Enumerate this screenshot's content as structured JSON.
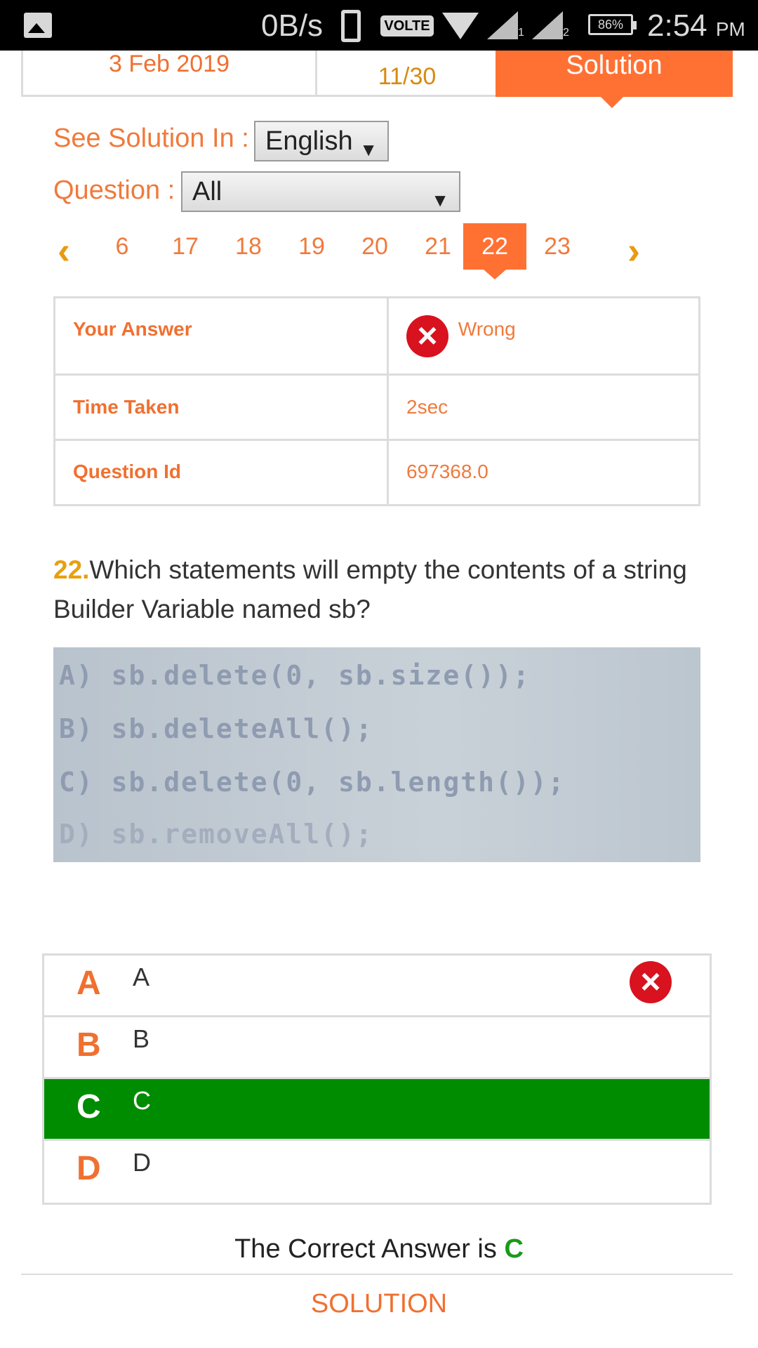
{
  "status_bar": {
    "speed": "0B/s",
    "volte": "VOLTE",
    "sim1": "1",
    "sim2": "2",
    "battery": "86%",
    "time": "2:54",
    "ampm": "PM"
  },
  "tabs": {
    "date": "3 Feb 2019",
    "score": "11/30",
    "solution": "Solution"
  },
  "controls": {
    "see_solution_label": "See Solution In :",
    "language": "English",
    "question_label": "Question :",
    "question_filter": "All",
    "dropdown_arrow": "▼"
  },
  "pager": {
    "prev": "‹",
    "next": "›",
    "pages": [
      "6",
      "17",
      "18",
      "19",
      "20",
      "21",
      "22",
      "23"
    ],
    "active": "22"
  },
  "info": {
    "your_answer_label": "Your Answer",
    "your_answer_value": "Wrong",
    "time_taken_label": "Time Taken",
    "time_taken_value": "2sec",
    "question_id_label": "Question Id",
    "question_id_value": "697368.0"
  },
  "question": {
    "number": "22.",
    "text": "Which statements will empty the contents of a string Builder Variable named sb?",
    "code_lines": [
      "A) sb.delete(0, sb.size());",
      "B) sb.deleteAll();",
      "C) sb.delete(0, sb.length());",
      "D) sb.removeAll();"
    ]
  },
  "options": [
    {
      "letter": "A",
      "text": "A",
      "state": "wrong"
    },
    {
      "letter": "B",
      "text": "B",
      "state": "normal"
    },
    {
      "letter": "C",
      "text": "C",
      "state": "correct"
    },
    {
      "letter": "D",
      "text": "D",
      "state": "normal"
    }
  ],
  "footer": {
    "correct_answer_prefix": "The Correct Answer is",
    "correct_answer_letter": "C",
    "solution_link": "SOLUTION"
  },
  "colors": {
    "accent_orange": "#ff7133",
    "correct_green": "#008c00",
    "wrong_red": "#d8121e"
  }
}
